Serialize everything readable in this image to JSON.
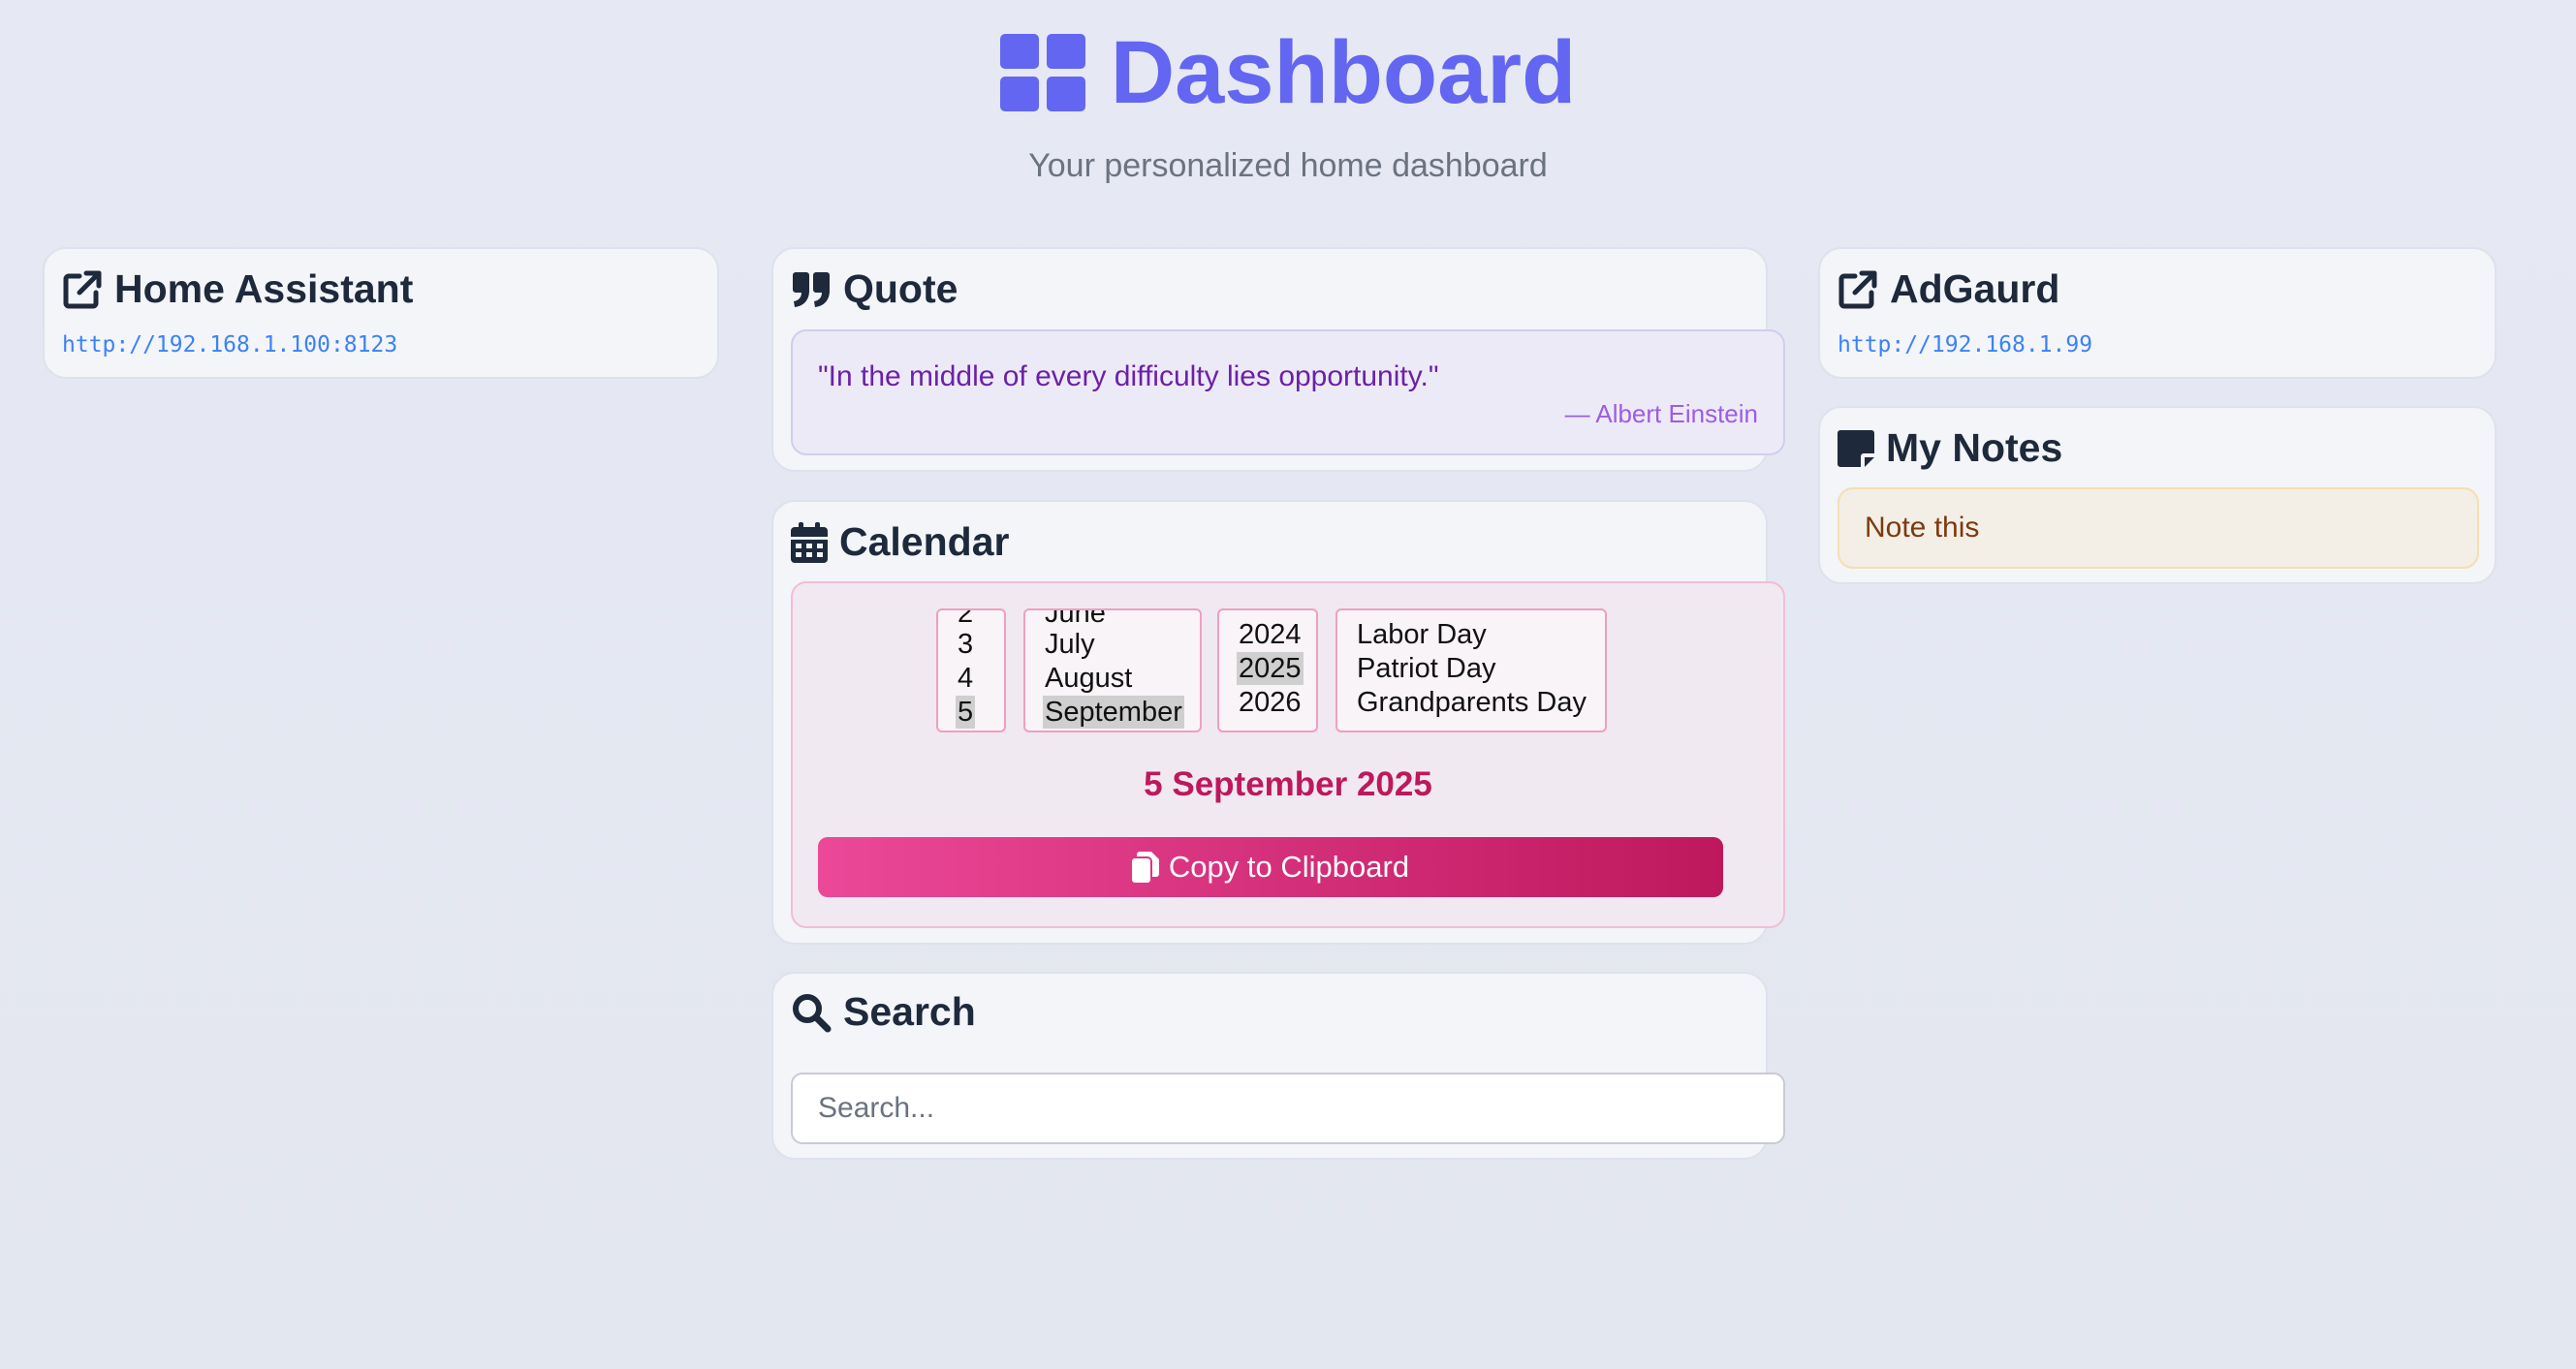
{
  "header": {
    "title": "Dashboard",
    "subtitle": "Your personalized home dashboard"
  },
  "home_assistant": {
    "title": "Home Assistant",
    "url": "http://192.168.1.100:8123"
  },
  "quote": {
    "title": "Quote",
    "text": "\"In the middle of every difficulty lies opportunity.\"",
    "author": "— Albert Einstein"
  },
  "calendar": {
    "title": "Calendar",
    "days": [
      "2",
      "3",
      "4",
      "5"
    ],
    "selected_day": "5",
    "months": [
      "June",
      "July",
      "August",
      "September"
    ],
    "selected_month": "September",
    "years": [
      "2024",
      "2025",
      "2026"
    ],
    "selected_year": "2025",
    "holidays": [
      "Labor Day",
      "Patriot Day",
      "Grandparents Day"
    ],
    "display_date": "5 September 2025",
    "copy_label": "Copy to Clipboard"
  },
  "search": {
    "title": "Search",
    "placeholder": "Search..."
  },
  "adguard": {
    "title": "AdGaurd",
    "url": "http://192.168.1.99"
  },
  "notes": {
    "title": "My Notes",
    "content": "Note this"
  },
  "colors": {
    "accent": "#6366f1",
    "calendar_accent": "#be185d",
    "link": "#3b82f6"
  },
  "icons": {
    "header": "grid-icon",
    "home_assistant": "external-link-icon",
    "quote": "quote-icon",
    "calendar": "calendar-icon",
    "search": "search-icon",
    "adguard": "external-link-icon",
    "notes": "sticky-note-icon",
    "copy": "copy-icon"
  }
}
